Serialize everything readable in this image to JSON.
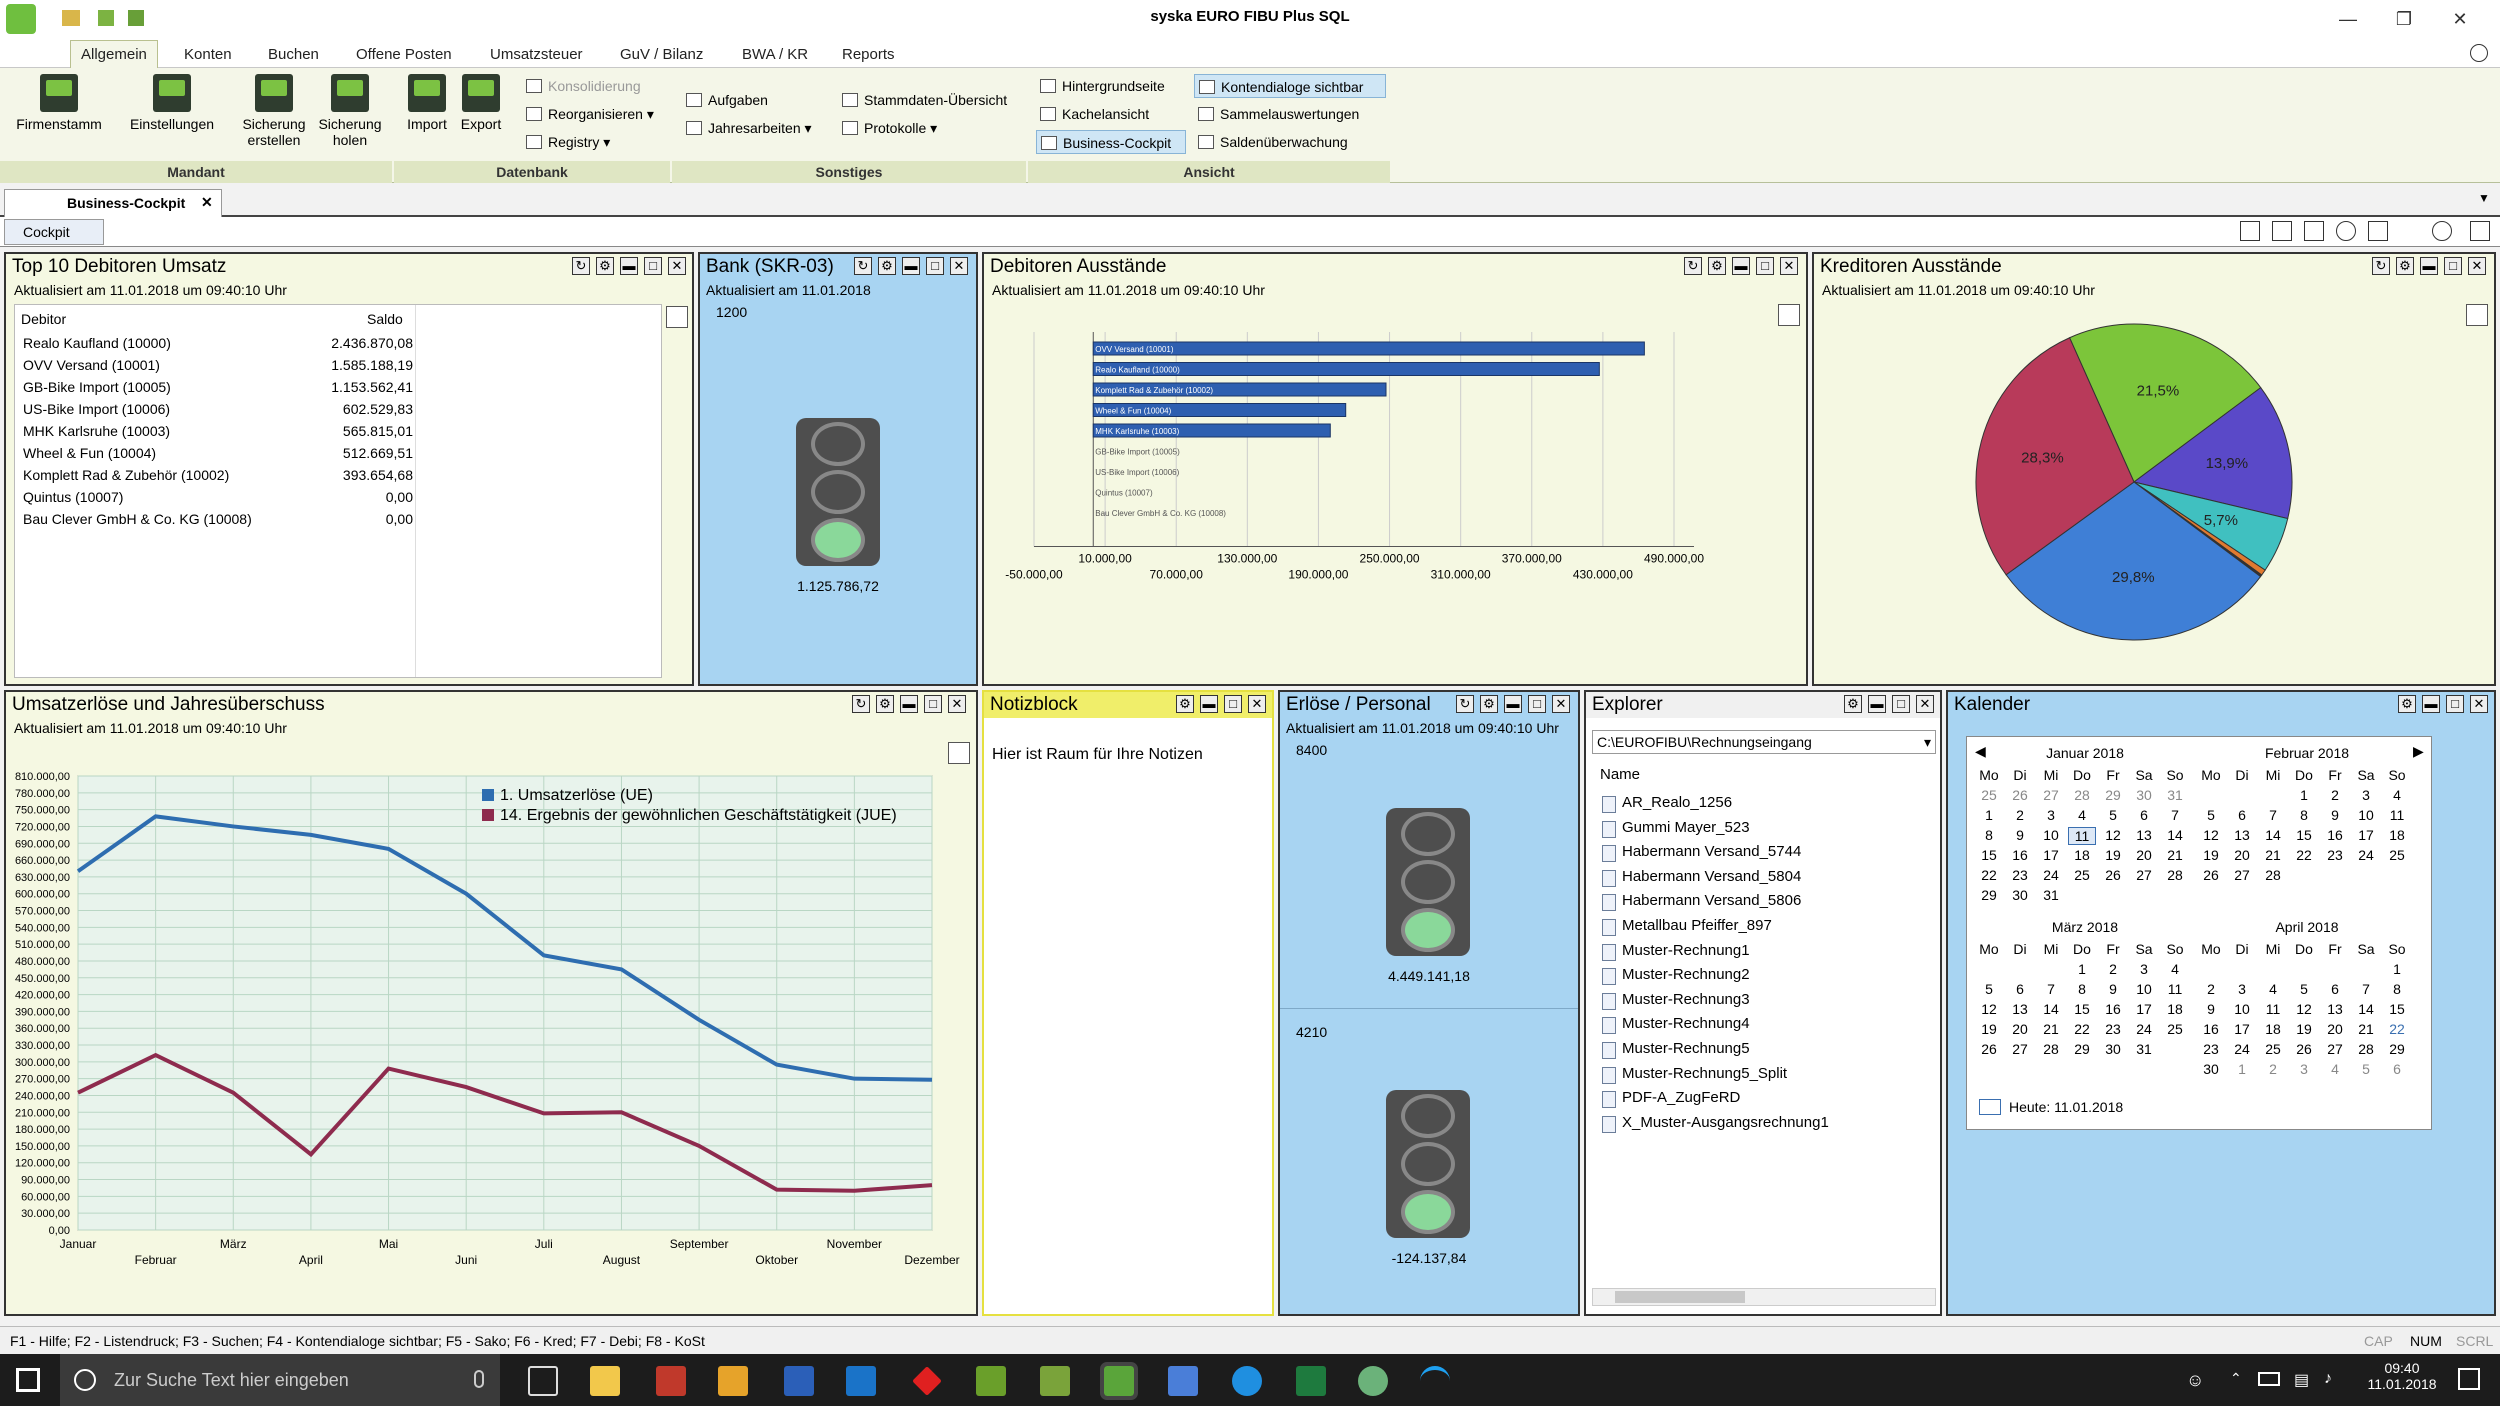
{
  "window": {
    "title": "syska EURO FIBU Plus SQL",
    "minimize": "—",
    "maximize": "❐",
    "close": "✕"
  },
  "ribbon_tabs": [
    "Allgemein",
    "Konten",
    "Buchen",
    "Offene Posten",
    "Umsatzsteuer",
    "GuV / Bilanz",
    "BWA / KR",
    "Reports"
  ],
  "ribbon": {
    "mandant": {
      "label": "Mandant",
      "buttons": [
        [
          "Firmenstamm",
          ""
        ],
        [
          "Einstellungen",
          ""
        ],
        [
          "Sicherung",
          "erstellen"
        ],
        [
          "Sicherung",
          "holen"
        ]
      ]
    },
    "datenbank": {
      "label": "Datenbank",
      "import": "Import",
      "export": "Export",
      "small": [
        "Konsolidierung",
        "Reorganisieren",
        "Registry"
      ]
    },
    "sonstiges": {
      "label": "Sonstiges",
      "small": [
        "Aufgaben",
        "Jahresarbeiten",
        "Stammdaten-Übersicht",
        "Protokolle"
      ]
    },
    "ansicht": {
      "label": "Ansicht",
      "small": [
        "Hintergrundseite",
        "Kachelansicht",
        "Business-Cockpit",
        "Kontendialoge sichtbar",
        "Sammelauswertungen",
        "Saldenüberwachung"
      ]
    }
  },
  "doc_tab": "Business-Cockpit",
  "sub_tab": "Cockpit",
  "panels": {
    "top10": {
      "title": "Top 10 Debitoren Umsatz",
      "updated": "Aktualisiert am 11.01.2018 um 09:40:10 Uhr",
      "col_debitor": "Debitor",
      "col_saldo": "Saldo",
      "rows": [
        [
          "Realo Kaufland (10000)",
          "2.436.870,08"
        ],
        [
          "OVV Versand (10001)",
          "1.585.188,19"
        ],
        [
          "GB-Bike Import (10005)",
          "1.153.562,41"
        ],
        [
          "US-Bike Import (10006)",
          "602.529,83"
        ],
        [
          "MHK Karlsruhe (10003)",
          "565.815,01"
        ],
        [
          "Wheel & Fun (10004)",
          "512.669,51"
        ],
        [
          "Komplett Rad & Zubehör (10002)",
          "393.654,68"
        ],
        [
          "Quintus (10007)",
          "0,00"
        ],
        [
          "Bau Clever GmbH & Co. KG (10008)",
          "0,00"
        ]
      ]
    },
    "bank": {
      "title": "Bank (SKR-03)",
      "updated": "Aktualisiert am 11.01.2018",
      "account": "1200",
      "value": "1.125.786,72"
    },
    "debitoren": {
      "title": "Debitoren Ausstände",
      "updated": "Aktualisiert am 11.01.2018 um 09:40:10 Uhr"
    },
    "kreditoren": {
      "title": "Kreditoren Ausstände",
      "updated": "Aktualisiert am 11.01.2018 um 09:40:10 Uhr"
    },
    "umsatz": {
      "title": "Umsatzerlöse und Jahresüberschuss",
      "updated": "Aktualisiert am 11.01.2018 um 09:40:10 Uhr"
    },
    "notiz": {
      "title": "Notizblock",
      "text": "Hier ist Raum für Ihre Notizen"
    },
    "erloese": {
      "title": "Erlöse / Personal",
      "updated": "Aktualisiert am 11.01.2018 um 09:40:10 Uhr",
      "acc1": "8400",
      "val1": "4.449.141,18",
      "acc2": "4210",
      "val2": "-124.137,84"
    },
    "explorer": {
      "title": "Explorer",
      "path": "C:\\EUROFIBU\\Rechnungseingang",
      "col": "Name",
      "items": [
        "AR_Realo_1256",
        "Gummi Mayer_523",
        "Habermann Versand_5744",
        "Habermann Versand_5804",
        "Habermann Versand_5806",
        "Metallbau Pfeiffer_897",
        "Muster-Rechnung1",
        "Muster-Rechnung2",
        "Muster-Rechnung3",
        "Muster-Rechnung4",
        "Muster-Rechnung5",
        "Muster-Rechnung5_Split",
        "PDF-A_ZugFeRD",
        "X_Muster-Ausgangsrechnung1"
      ]
    },
    "kalender": {
      "title": "Kalender",
      "today": "Heute: 11.01.2018",
      "weekdays": [
        "Mo",
        "Di",
        "Mi",
        "Do",
        "Fr",
        "Sa",
        "So"
      ],
      "months": [
        {
          "name": "Januar 2018",
          "days": [
            "25",
            "26",
            "27",
            "28",
            "29",
            "30",
            "31",
            "1",
            "2",
            "3",
            "4",
            "5",
            "6",
            "7",
            "8",
            "9",
            "10",
            "11",
            "12",
            "13",
            "14",
            "15",
            "16",
            "17",
            "18",
            "19",
            "20",
            "21",
            "22",
            "23",
            "24",
            "25",
            "26",
            "27",
            "28",
            "29",
            "30",
            "31"
          ]
        },
        {
          "name": "Februar 2018",
          "days": [
            "",
            "",
            "",
            "1",
            "2",
            "3",
            "4",
            "5",
            "6",
            "7",
            "8",
            "9",
            "10",
            "11",
            "12",
            "13",
            "14",
            "15",
            "16",
            "17",
            "18",
            "19",
            "20",
            "21",
            "22",
            "23",
            "24",
            "25",
            "26",
            "27",
            "28"
          ]
        },
        {
          "name": "März 2018",
          "days": [
            "",
            "",
            "",
            "1",
            "2",
            "3",
            "4",
            "5",
            "6",
            "7",
            "8",
            "9",
            "10",
            "11",
            "12",
            "13",
            "14",
            "15",
            "16",
            "17",
            "18",
            "19",
            "20",
            "21",
            "22",
            "23",
            "24",
            "25",
            "26",
            "27",
            "28",
            "29",
            "30",
            "31"
          ]
        },
        {
          "name": "April 2018",
          "days": [
            "",
            "",
            "",
            "",
            "",
            "",
            "1",
            "2",
            "3",
            "4",
            "5",
            "6",
            "7",
            "8",
            "9",
            "10",
            "11",
            "12",
            "13",
            "14",
            "15",
            "16",
            "17",
            "18",
            "19",
            "20",
            "21",
            "22",
            "23",
            "24",
            "25",
            "26",
            "27",
            "28",
            "29",
            "30",
            "1",
            "2",
            "3",
            "4",
            "5",
            "6"
          ]
        }
      ]
    }
  },
  "chart_data": [
    {
      "type": "bar",
      "orientation": "horizontal",
      "title": "Debitoren Ausstände",
      "categories": [
        "OVV Versand (10001)",
        "Realo Kaufland (10000)",
        "Komplett Rad & Zubehör (10002)",
        "Wheel & Fun (10004)",
        "MHK Karlsruhe (10003)",
        "GB-Bike Import (10005)",
        "US-Bike Import (10006)",
        "Quintus (10007)",
        "Bau Clever GmbH & Co. KG (10008)"
      ],
      "values": [
        465000,
        427000,
        247000,
        213000,
        200000,
        0,
        0,
        0,
        0
      ],
      "x_ticks_top": [
        "10.000,00",
        "130.000,00",
        "250.000,00",
        "370.000,00",
        "490.000,00"
      ],
      "x_ticks_bottom": [
        "-50.000,00",
        "70.000,00",
        "190.000,00",
        "310.000,00",
        "430.000,00"
      ],
      "xlim": [
        -50000,
        490000
      ],
      "color": "#2e5fb0"
    },
    {
      "type": "pie",
      "title": "Kreditoren Ausstände",
      "labels": [
        "21,5%",
        "13,9%",
        "5,7%",
        "29,8%",
        "28,3%"
      ],
      "values": [
        21.5,
        13.9,
        5.7,
        0.6,
        0.2,
        29.8,
        28.3
      ],
      "colors": [
        "#7cc53a",
        "#5a49c8",
        "#40c0c0",
        "#e07a30",
        "#333333",
        "#3f7fd6",
        "#b83a5a"
      ]
    },
    {
      "type": "line",
      "title": "Umsatzerlöse und Jahresüberschuss",
      "categories": [
        "Januar",
        "Februar",
        "März",
        "April",
        "Mai",
        "Juni",
        "Juli",
        "August",
        "September",
        "Oktober",
        "November",
        "Dezember"
      ],
      "series": [
        {
          "name": "1. Umsatzerlöse (UE)",
          "color": "#2e6db0",
          "values": [
            640000,
            738000,
            720000,
            705000,
            680000,
            600000,
            490000,
            465000,
            375000,
            295000,
            270000,
            268000
          ]
        },
        {
          "name": "14. Ergebnis der gewöhnlichen Geschäftstätigkeit (JUE)",
          "color": "#8e2b4e",
          "values": [
            245000,
            312000,
            245000,
            135000,
            288000,
            255000,
            208000,
            210000,
            150000,
            72000,
            70000,
            80000
          ]
        }
      ],
      "ylim": [
        0,
        810000
      ],
      "y_ticks": [
        "810.000,00",
        "780.000,00",
        "750.000,00",
        "720.000,00",
        "690.000,00",
        "660.000,00",
        "630.000,00",
        "600.000,00",
        "570.000,00",
        "540.000,00",
        "510.000,00",
        "480.000,00",
        "450.000,00",
        "420.000,00",
        "390.000,00",
        "360.000,00",
        "330.000,00",
        "300.000,00",
        "270.000,00",
        "240.000,00",
        "210.000,00",
        "180.000,00",
        "150.000,00",
        "120.000,00",
        "90.000,00",
        "60.000,00",
        "30.000,00",
        "0,00"
      ]
    }
  ],
  "statusbar": {
    "hint": "F1 - Hilfe; F2 - Listendruck; F3 - Suchen; F4 - Kontendialoge sichtbar; F5 - Sako; F6 - Kred; F7 - Debi; F8 - KoSt",
    "caps": "CAP",
    "num": "NUM",
    "scrl": "SCRL"
  },
  "taskbar": {
    "search": "Zur Suche Text hier eingeben",
    "time": "09:40",
    "date": "11.01.2018"
  }
}
